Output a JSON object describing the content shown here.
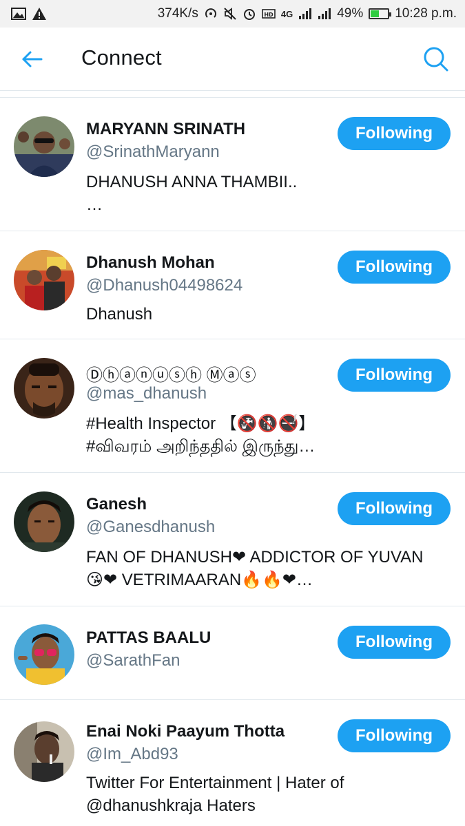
{
  "status_bar": {
    "speed": "374K/s",
    "network_small": "4G",
    "battery_percent": "49%",
    "battery_level": 0.49,
    "time": "10:28 p.m."
  },
  "app_bar": {
    "title": "Connect"
  },
  "colors": {
    "accent": "#1da1f2",
    "handle_gray": "#657786",
    "divider": "#e1e8ed"
  },
  "users": [
    {
      "name": "MARYANN SRINATH",
      "handle": "@SrinathMaryann",
      "bio": [
        "DHANUSH ANNA THAMBII..",
        "…"
      ],
      "follow_label": "Following"
    },
    {
      "name": "Dhanush Mohan",
      "handle": "@Dhanush04498624",
      "bio": [
        "Dhanush"
      ],
      "follow_label": "Following"
    },
    {
      "name": "Ⓓⓗⓐⓝⓤⓢⓗ Ⓜⓐⓢ",
      "handle": "@mas_dhanush",
      "bio": [
        "#Health Inspector 【🚱🚯🚭】",
        "#விவரம் அறிந்ததில் இருந்து…"
      ],
      "follow_label": "Following"
    },
    {
      "name": "Ganesh",
      "handle": "@Ganesdhanush",
      "bio": [
        "FAN OF DHANUSH❤ ADDICTOR OF YUVAN",
        "😘❤ VETRIMAARAN🔥🔥❤…"
      ],
      "follow_label": "Following"
    },
    {
      "name": "PATTAS BAALU",
      "handle": "@SarathFan",
      "bio": [],
      "follow_label": "Following"
    },
    {
      "name": "Enai Noki Paayum Thotta",
      "handle": "@Im_Abd93",
      "bio": [
        "Twitter For Entertainment  | Hater of",
        "@dhanushkraja Haters"
      ],
      "follow_label": "Following"
    }
  ]
}
